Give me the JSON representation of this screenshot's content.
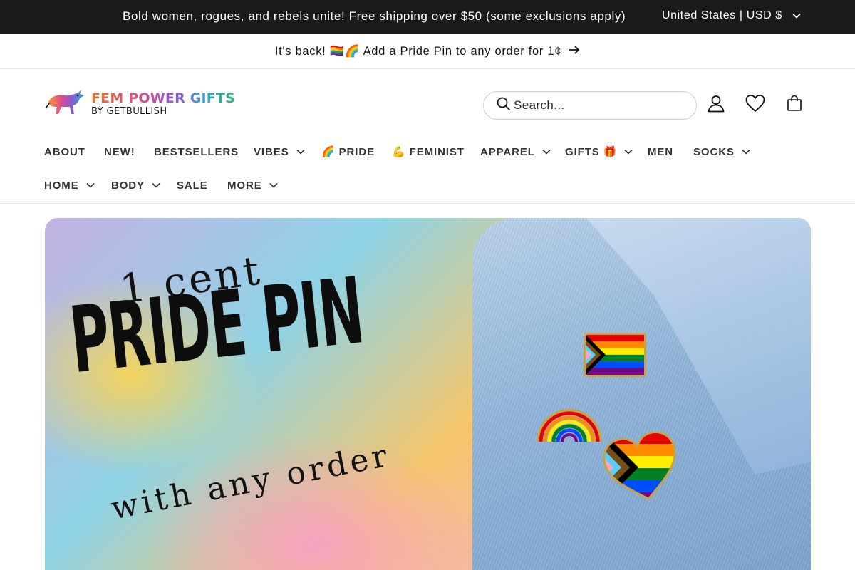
{
  "announcement": {
    "message": "Bold women, rogues, and rebels unite! Free shipping over $50 (some exclusions apply)",
    "locale": "United States | USD $"
  },
  "promo": {
    "text": "It's back! 🏳️‍🌈🌈 Add a Pride Pin to any order for 1¢"
  },
  "header": {
    "logo_brand": "FEM POWER GIFTS",
    "logo_sub": "BY GETBULLISH",
    "search_placeholder": "Search...",
    "icons": [
      "account-icon",
      "wishlist-heart-icon",
      "cart-icon"
    ]
  },
  "nav": {
    "row1": [
      {
        "label": "ABOUT",
        "dropdown": false
      },
      {
        "label": "NEW!",
        "dropdown": false
      },
      {
        "label": "BESTSELLERS",
        "dropdown": false
      },
      {
        "label": "VIBES",
        "dropdown": true
      },
      {
        "label": "🌈 PRIDE",
        "dropdown": false
      },
      {
        "label": "💪 FEMINIST",
        "dropdown": false
      },
      {
        "label": "APPAREL",
        "dropdown": true
      },
      {
        "label": "GIFTS 🎁",
        "dropdown": true
      },
      {
        "label": "MEN",
        "dropdown": false
      },
      {
        "label": "SOCKS",
        "dropdown": true
      }
    ],
    "row2": [
      {
        "label": "HOME",
        "dropdown": true
      },
      {
        "label": "BODY",
        "dropdown": true
      },
      {
        "label": "SALE",
        "dropdown": false
      },
      {
        "label": "MORE",
        "dropdown": true
      }
    ]
  },
  "hero": {
    "line1": "1 cent",
    "line2": "PRIDE PIN",
    "line3": "with any order",
    "colors": {
      "yellow": "#f5c842",
      "pink": "#f7a8c4",
      "blue": "#8fd3e6",
      "denim": "#8fb4d9"
    }
  }
}
